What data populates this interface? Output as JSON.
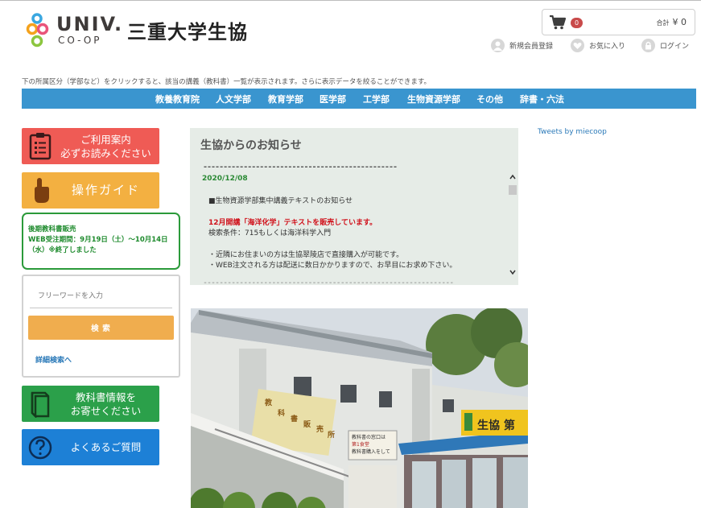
{
  "header": {
    "logo_univ": "UNIV.",
    "logo_coop": "CO-OP",
    "site_title": "三重大学生協",
    "cart": {
      "badge": "0",
      "total_label": "合計",
      "total_value": "¥ 0"
    },
    "account_links": {
      "register": "新規会員登録",
      "favorites": "お気に入り",
      "login": "ログイン"
    }
  },
  "notice_line": "下の所属区分（学部など）をクリックすると、該当の講義（教科書）一覧が表示されます。さらに表示データを絞ることができます。",
  "nav": {
    "items": [
      "教養教育院",
      "人文学部",
      "教育学部",
      "医学部",
      "工学部",
      "生物資源学部",
      "その他",
      "辞書・六法"
    ]
  },
  "sidebar": {
    "guide_line1": "ご利用案内",
    "guide_line2": "必ずお読みください",
    "operation_guide": "操作ガイド",
    "sale_line1": "後期教科書販売",
    "sale_line2": "WEB受注期間：9月19日（土）〜10月14日",
    "sale_line3": "（水）※終了しました",
    "search_placeholder": "フリーワードを入力",
    "search_button": "検 索",
    "advanced_search": "詳細検索へ",
    "info_line1": "教科書情報を",
    "info_line2": "お寄せください",
    "faq": "よくあるご質問"
  },
  "news": {
    "title": "生協からのお知らせ",
    "divider": "------------------------------------------------",
    "divider_bottom": "--------------------------------------------------------------",
    "date": "2020/12/08",
    "heading": "■生物資源学部集中講義テキストのお知らせ",
    "highlight": "12月開講「海洋化学」テキストを販売しています。",
    "search_condition": "検索条件：715もしくは海洋科学入門",
    "bullet1": "・近隣にお住まいの方は生協翠陵店で直接購入が可能です。",
    "bullet2": "・WEB注文される方は配送に数日かかりますので、お早目にお求め下さい。"
  },
  "tweets_link": "Tweets by miecoop",
  "photo_signs": {
    "vertical_sign": [
      "教",
      "科",
      "書",
      "販",
      "売",
      "所"
    ],
    "coop_sign": "生協 第",
    "board_line1": "教科書の窓口は",
    "board_line2": "第1食堂",
    "board_line3": "教科書購入をして"
  },
  "colors": {
    "nav_bg": "#3a95cf",
    "guide_btn": "#ef5b55",
    "operation_btn": "#f3b041",
    "info_btn": "#2ba04a",
    "faq_btn": "#1d80d6",
    "sale_border": "#2b9a3a",
    "search_btn": "#f0ad4e",
    "news_bg": "#e6ece7",
    "news_highlight": "#d0101a"
  }
}
